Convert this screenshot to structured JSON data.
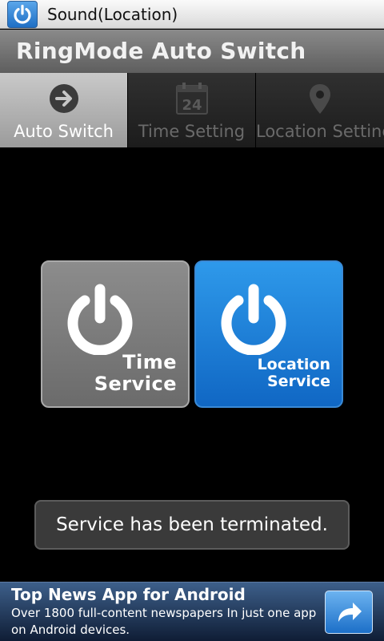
{
  "titlebar": {
    "title": "Sound(Location)",
    "icon": "power-icon"
  },
  "header": {
    "title": "RingMode Auto Switch"
  },
  "tabs": [
    {
      "label": "Auto Switch",
      "icon": "arrow-right-icon",
      "active": true
    },
    {
      "label": "Time Setting",
      "icon": "calendar-icon",
      "active": false,
      "icon_text": "24"
    },
    {
      "label": "Location Setting",
      "icon": "location-pin-icon",
      "active": false
    }
  ],
  "services": {
    "time": {
      "label": "Time\nService",
      "color": "#7a7a7a",
      "icon": "power-icon"
    },
    "location": {
      "label": "Location\nService",
      "color": "#1f7fd8",
      "icon": "power-icon"
    }
  },
  "toast": {
    "message": "Service has been terminated."
  },
  "ad": {
    "title": "Top News App for Android",
    "body": "Over 1800 full-content newspapers In just one app on Android devices.",
    "button_icon": "share-arrow-icon"
  }
}
